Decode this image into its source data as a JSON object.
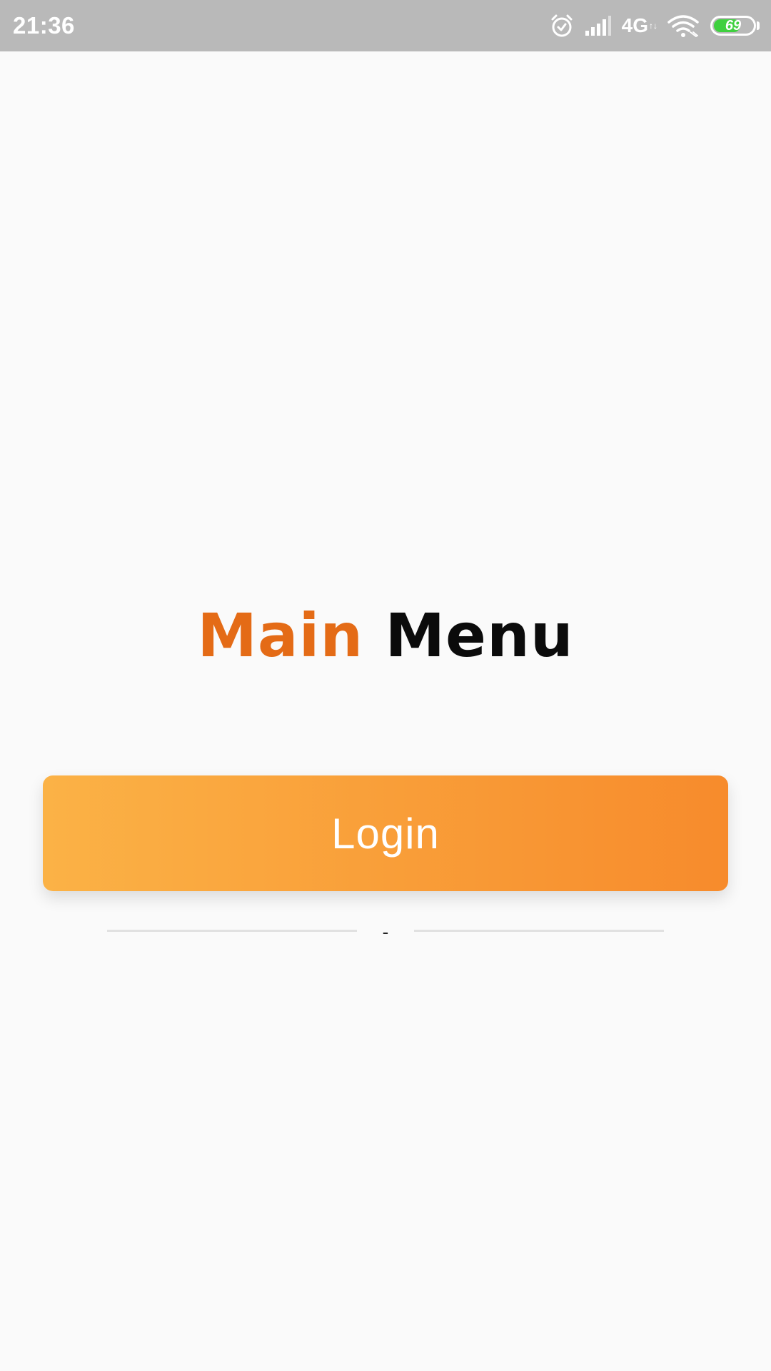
{
  "status_bar": {
    "time": "21:36",
    "network_type": "4G",
    "network_arrows": "↑↓",
    "battery_level": "69",
    "battery_fraction": 0.69,
    "icons": [
      "alarm-icon",
      "cellular-signal-icon",
      "wifi-icon",
      "battery-icon"
    ]
  },
  "title": {
    "accent_word": "Main",
    "rest_word": "Menu",
    "accent_color": "#e46b16"
  },
  "login_button": {
    "label": "Login",
    "gradient_start": "#fbb246",
    "gradient_end": "#f78b2c"
  },
  "divider": {
    "text": "-"
  }
}
